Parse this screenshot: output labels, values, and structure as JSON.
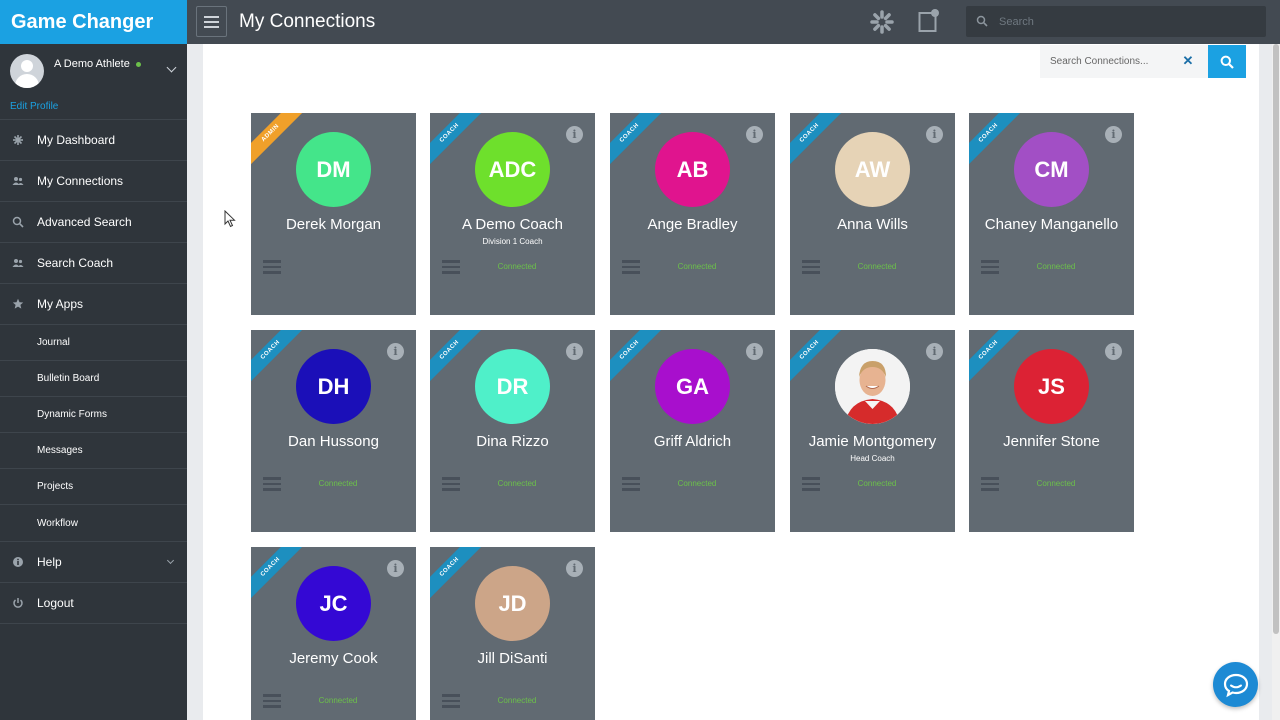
{
  "brand": "Game Changer",
  "profile": {
    "name": "A Demo Athlete",
    "edit_label": "Edit Profile"
  },
  "nav": {
    "items": [
      {
        "label": "My Dashboard",
        "icon": "dashboard-icon"
      },
      {
        "label": "My Connections",
        "icon": "users-icon"
      },
      {
        "label": "Advanced Search",
        "icon": "search-icon"
      },
      {
        "label": "Search Coach",
        "icon": "users-icon"
      },
      {
        "label": "My Apps",
        "icon": "star-icon"
      }
    ],
    "sub_items": [
      "Journal",
      "Bulletin Board",
      "Dynamic Forms",
      "Messages",
      "Projects",
      "Workflow"
    ],
    "help": "Help",
    "logout": "Logout"
  },
  "header": {
    "title": "My Connections",
    "search_placeholder": "Search"
  },
  "connections_search": {
    "placeholder": "Search Connections..."
  },
  "colors": {
    "brand": "#1ba1e2",
    "card": "#616a72",
    "coach_ribbon": "#1d8fbf",
    "admin_ribbon": "#f0a02a",
    "connected": "#6cc04a"
  },
  "cards": [
    {
      "initials": "DM",
      "name": "Derek Morgan",
      "title": "",
      "role": "ADMIN",
      "status": "",
      "color": "#44e58a",
      "info": false
    },
    {
      "initials": "ADC",
      "name": "A Demo Coach",
      "title": "Division 1 Coach",
      "role": "COACH",
      "status": "Connected",
      "color": "#6ee02c",
      "info": true
    },
    {
      "initials": "AB",
      "name": "Ange Bradley",
      "title": "",
      "role": "COACH",
      "status": "Connected",
      "color": "#e0148e",
      "info": true
    },
    {
      "initials": "AW",
      "name": "Anna Wills",
      "title": "",
      "role": "COACH",
      "status": "Connected",
      "color": "#e6d3b6",
      "info": true
    },
    {
      "initials": "CM",
      "name": "Chaney Manganello",
      "title": "",
      "role": "COACH",
      "status": "Connected",
      "color": "#a24fc5",
      "info": true
    },
    {
      "initials": "DH",
      "name": "Dan Hussong",
      "title": "",
      "role": "COACH",
      "status": "Connected",
      "color": "#1b0fb8",
      "info": true
    },
    {
      "initials": "DR",
      "name": "Dina Rizzo",
      "title": "",
      "role": "COACH",
      "status": "Connected",
      "color": "#4ff0c9",
      "info": true
    },
    {
      "initials": "GA",
      "name": "Griff Aldrich",
      "title": "",
      "role": "COACH",
      "status": "Connected",
      "color": "#a80fcd",
      "info": true
    },
    {
      "initials": "",
      "name": "Jamie Montgomery",
      "title": "Head Coach",
      "role": "COACH",
      "status": "Connected",
      "color": "#f3f3f3",
      "info": true,
      "photo": true
    },
    {
      "initials": "JS",
      "name": "Jennifer Stone",
      "title": "",
      "role": "COACH",
      "status": "Connected",
      "color": "#dc2234",
      "info": true
    },
    {
      "initials": "JC",
      "name": "Jeremy Cook",
      "title": "",
      "role": "COACH",
      "status": "Connected",
      "color": "#3408d4",
      "info": true
    },
    {
      "initials": "JD",
      "name": "Jill DiSanti",
      "title": "",
      "role": "COACH",
      "status": "Connected",
      "color": "#cca588",
      "info": true
    }
  ]
}
